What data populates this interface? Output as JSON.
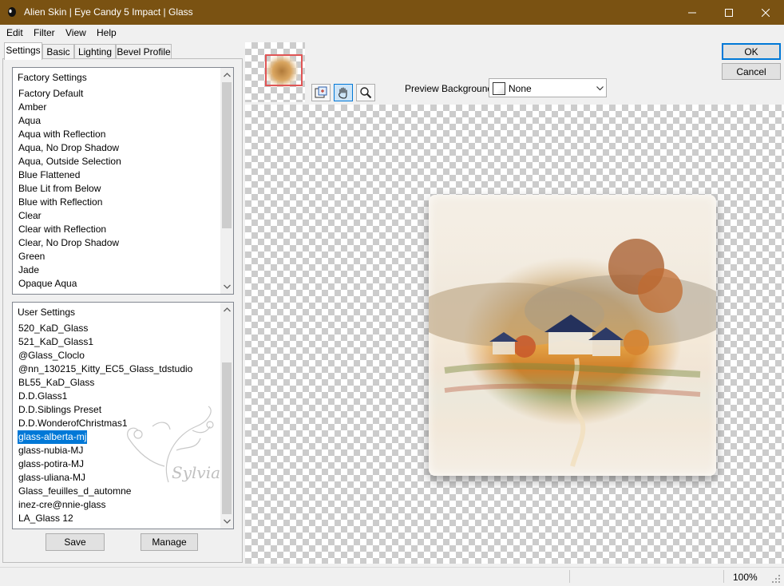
{
  "window": {
    "title": "Alien Skin | Eye Candy 5 Impact | Glass",
    "title_bar_color": "#7a5212",
    "controls": [
      "minimize-icon",
      "maximize-icon",
      "close-icon"
    ]
  },
  "menu": [
    "Edit",
    "Filter",
    "View",
    "Help"
  ],
  "tabs": [
    "Settings",
    "Basic",
    "Lighting",
    "Bevel Profile"
  ],
  "factory_settings": {
    "header": "Factory Settings",
    "items": [
      "Factory Default",
      "Amber",
      "Aqua",
      "Aqua with Reflection",
      "Aqua, No Drop Shadow",
      "Aqua, Outside Selection",
      "Blue Flattened",
      "Blue Lit from Below",
      "Blue with Reflection",
      "Clear",
      "Clear with Reflection",
      "Clear, No Drop Shadow",
      "Green",
      "Jade",
      "Opaque Aqua"
    ]
  },
  "user_settings": {
    "header": "User Settings",
    "items": [
      "520_KaD_Glass",
      "521_KaD_Glass1",
      "@Glass_Cloclo",
      "@nn_130215_Kitty_EC5_Glass_tdstudio",
      "BL55_KaD_Glass",
      "D.D.Glass1",
      "D.D.Siblings Preset",
      "D.D.WonderofChristmas1",
      "glass-alberta-mj",
      "glass-nubia-MJ",
      "glass-potira-MJ",
      "glass-uliana-MJ",
      "Glass_feuilles_d_automne",
      "inez-cre@nnie-glass",
      "LA_Glass 12"
    ],
    "selected_index": 8,
    "watermark": "Sylviane"
  },
  "buttons": {
    "save": "Save",
    "manage": "Manage",
    "ok": "OK",
    "cancel": "Cancel"
  },
  "preview": {
    "background_label": "Preview Background:",
    "background_value": "None",
    "tools": [
      "navigator-icon",
      "hand-pan-icon",
      "zoom-icon"
    ],
    "active_tool_index": 1,
    "zoom": "100%",
    "accent": "#0078d7"
  }
}
